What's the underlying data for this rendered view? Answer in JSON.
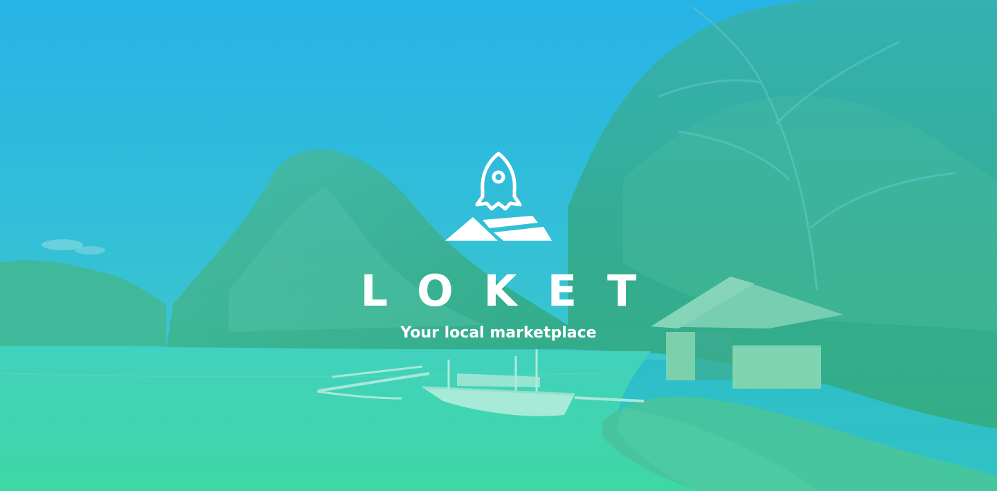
{
  "brand": {
    "name": "LOKET",
    "tagline": "Your local marketplace",
    "logo_icon": "rocket-over-map-icon"
  },
  "colors": {
    "sky_top": "#29b3e6",
    "sky_low": "#38c0e0",
    "water": "#3fd3b4",
    "foliage": "#3aa57c",
    "text": "#ffffff"
  }
}
